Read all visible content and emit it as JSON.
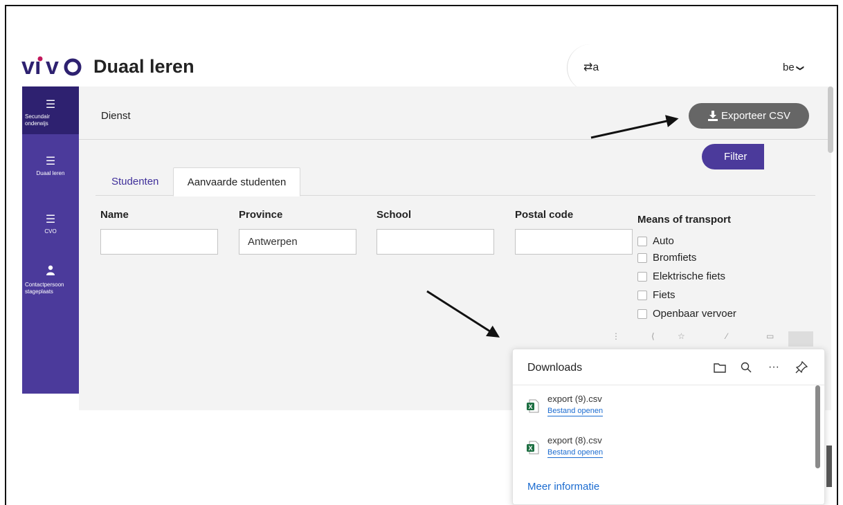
{
  "header": {
    "logo_text": "vivo",
    "app_title": "Duaal leren",
    "swap_icon": "⇄a",
    "language": "be",
    "language_chevron": "❯"
  },
  "sidebar": {
    "items": [
      {
        "icon": "list-icon",
        "label": "Secundair onderwijs",
        "active": true
      },
      {
        "icon": "list-icon",
        "label": "Duaal leren",
        "active": false
      },
      {
        "icon": "list-icon",
        "label": "CVO",
        "active": false
      },
      {
        "icon": "person-icon",
        "label": "Contactpersoon stageplaats",
        "active": false
      }
    ]
  },
  "toolbar": {
    "section_label": "Dienst",
    "export_label": "Exporteer CSV"
  },
  "tabs": [
    {
      "label": "Studenten",
      "active": false
    },
    {
      "label": "Aanvaarde studenten",
      "active": true
    }
  ],
  "filters": {
    "name": {
      "label": "Name",
      "value": ""
    },
    "province": {
      "label": "Province",
      "value": "Antwerpen"
    },
    "school": {
      "label": "School",
      "value": ""
    },
    "postal_code": {
      "label": "Postal code",
      "value": ""
    },
    "transport": {
      "label": "Means of transport",
      "options": [
        "Auto",
        "Bromfiets",
        "Elektrische fiets",
        "Fiets",
        "Openbaar vervoer"
      ]
    },
    "filter_button": "Filter"
  },
  "downloads": {
    "title": "Downloads",
    "items": [
      {
        "filename": "export (9).csv",
        "action": "Bestand openen"
      },
      {
        "filename": "export (8).csv",
        "action": "Bestand openen"
      }
    ],
    "more_link": "Meer informatie"
  },
  "colors": {
    "brand_purple": "#4b3a9b",
    "sidebar_active": "#2e2170",
    "logo_pink": "#c2185b",
    "export_button": "#666666",
    "link_blue": "#1a6bd0",
    "excel_green": "#1d6f42"
  }
}
